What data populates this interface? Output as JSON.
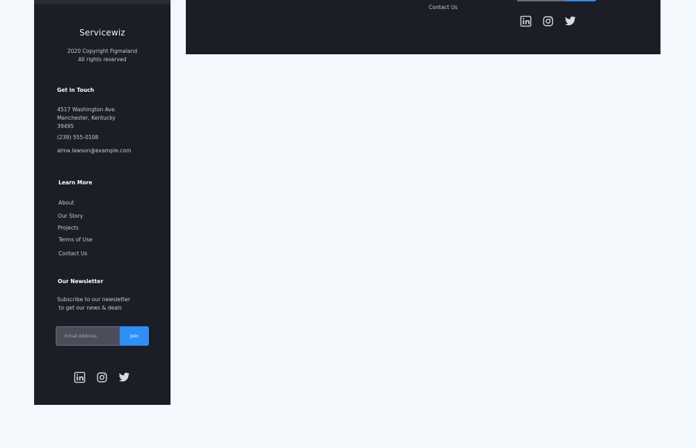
{
  "mobile_footer": {
    "brand": "Servicewiz",
    "copyright_line1": "2020 Copyright Figmaland",
    "copyright_line2": "All rights reserved",
    "get_in_touch": {
      "title": "Get in Touch",
      "address_line1": "4517 Washington Ave.",
      "address_line2": "Manchester, Kentucky",
      "address_line3": "39495",
      "phone": "(239) 555-0108",
      "email": "alma.lawson@example.com"
    },
    "learn_more": {
      "title": "Learn More",
      "links": [
        "About",
        "Our Story",
        "Projects",
        "Terms of Use",
        "Contact Us"
      ]
    },
    "newsletter": {
      "title": "Our Newsletter",
      "desc_line1": "Subscribe to our newsletter",
      "desc_line2": " to get our news & deals",
      "placeholder": "Email Address",
      "join_label": "Join"
    },
    "social_icons": [
      "linkedin-icon",
      "instagram-icon",
      "twitter-icon"
    ]
  },
  "desktop_footer": {
    "contact_link": "Contact Us",
    "social_icons": [
      "linkedin-icon",
      "instagram-icon",
      "twitter-icon"
    ]
  },
  "colors": {
    "page_bg": "#f3f8fd",
    "footer_bg": "#1b1d27",
    "accent": "#2f8ff5",
    "input_bg": "#4b4e59"
  }
}
